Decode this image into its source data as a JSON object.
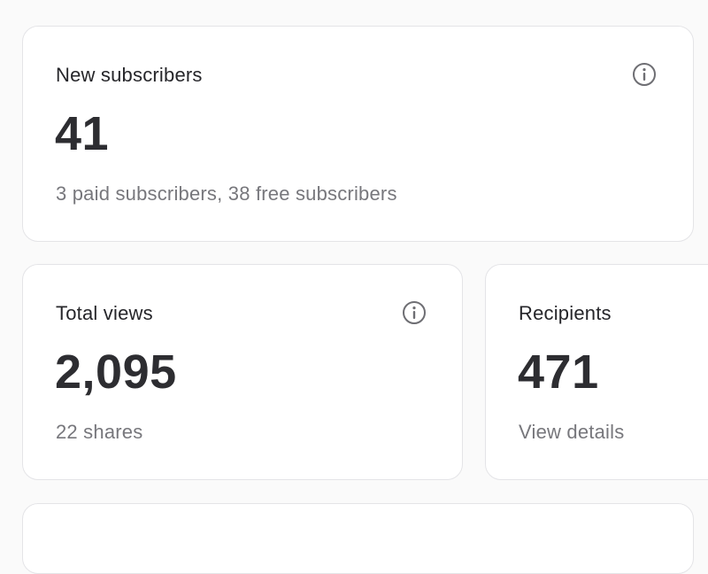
{
  "new_subscribers": {
    "title": "New subscribers",
    "value": "41",
    "detail": "3 paid subscribers, 38 free subscribers",
    "icon": "info-icon"
  },
  "total_views": {
    "title": "Total views",
    "value": "2,095",
    "detail": "22 shares",
    "icon": "info-icon"
  },
  "recipients": {
    "title": "Recipients",
    "value": "471",
    "link": "View details"
  }
}
